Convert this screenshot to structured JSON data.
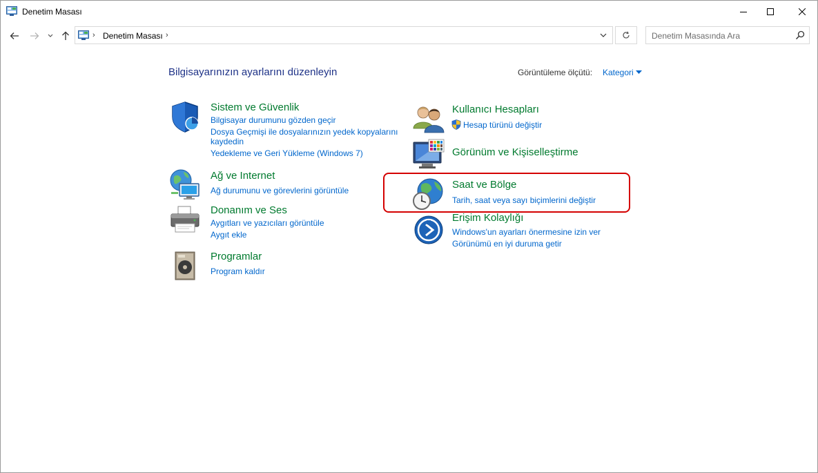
{
  "window": {
    "title": "Denetim Masası"
  },
  "address": {
    "crumb": "Denetim Masası",
    "separator": "›"
  },
  "search": {
    "placeholder": "Denetim Masasında Ara"
  },
  "main": {
    "heading": "Bilgisayarınızın ayarlarını düzenleyin",
    "view_by_label": "Görüntüleme ölçütü:",
    "view_by_value": "Kategori"
  },
  "categories": {
    "system_security": {
      "title": "Sistem ve Güvenlik",
      "links": [
        "Bilgisayar durumunu gözden geçir",
        "Dosya Geçmişi ile dosyalarınızın yedek kopyalarını",
        "kaydedin",
        "Yedekleme ve Geri Yükleme (Windows 7)"
      ]
    },
    "network": {
      "title": "Ağ ve Internet",
      "links": [
        "Ağ durumunu ve görevlerini görüntüle"
      ]
    },
    "hardware": {
      "title": "Donanım ve Ses",
      "links": [
        "Aygıtları ve yazıcıları görüntüle",
        "Aygıt ekle"
      ]
    },
    "programs": {
      "title": "Programlar",
      "links": [
        "Program kaldır"
      ]
    },
    "user_accounts": {
      "title": "Kullanıcı Hesapları",
      "links": [
        "Hesap türünü değiştir"
      ]
    },
    "appearance": {
      "title": "Görünüm ve Kişiselleştirme",
      "links": []
    },
    "clock_region": {
      "title": "Saat ve Bölge",
      "links": [
        "Tarih, saat veya sayı biçimlerini değiştir"
      ]
    },
    "ease_of_access": {
      "title": "Erişim Kolaylığı",
      "links": [
        "Windows'un ayarları önermesine izin ver",
        "Görünümü en iyi duruma getir"
      ]
    }
  },
  "colors": {
    "category_title": "#007a2e",
    "link": "#0066cc",
    "heading": "#1e3287",
    "highlight": "#d40000"
  },
  "icons": [
    "control-panel-icon",
    "shield-icon",
    "network-icon",
    "printer-icon",
    "programs-icon",
    "users-icon",
    "uac-shield-icon",
    "display-icon",
    "globe-clock-icon",
    "accessibility-icon"
  ]
}
